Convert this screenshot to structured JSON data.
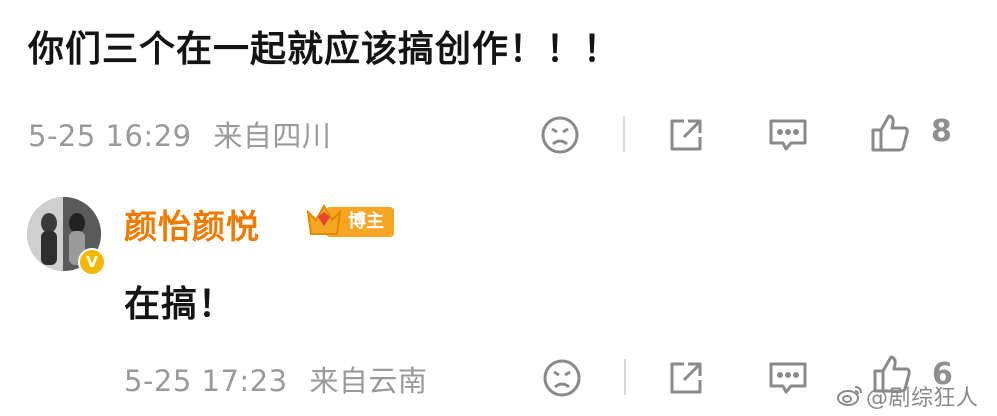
{
  "top_comment": {
    "text": "你们三个在一起就应该搞创作！！！",
    "date": "5-25 16:29",
    "location": "来自四川",
    "like_count": "8"
  },
  "reply": {
    "username": "颜怡颜悦",
    "badge_label": "博主",
    "verify_mark": "V",
    "text": "在搞！",
    "date": "5-25 17:23",
    "location": "来自云南",
    "like_count": "6"
  },
  "icons": {
    "dislike": "sad-face-icon",
    "share": "share-icon",
    "comment": "comment-icon",
    "like": "thumbs-up-icon",
    "badge": "crown-icon",
    "watermark": "weibo-logo-icon"
  },
  "watermark": {
    "text": "@剧综狂人"
  },
  "colors": {
    "username": "#ef7a00",
    "badge": "#f6a623",
    "meta_text": "#9a9a9a",
    "icon": "#8a8a8a"
  }
}
